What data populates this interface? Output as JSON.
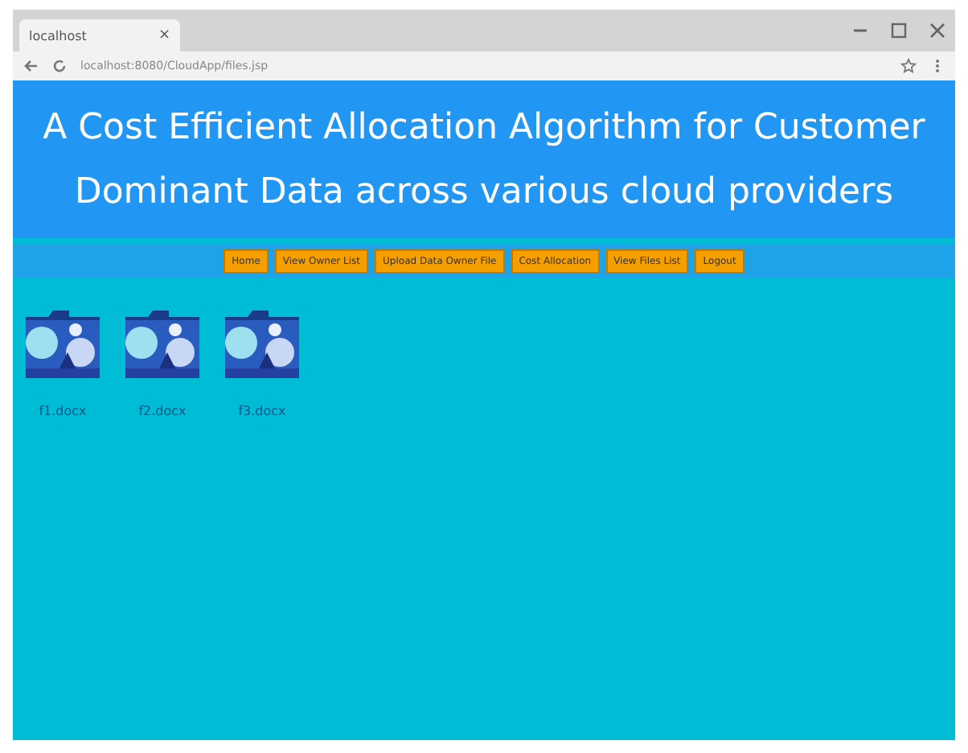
{
  "browser": {
    "tab_title": "localhost",
    "tab_close": "×",
    "address": "localhost:8080/CloudApp/files.jsp"
  },
  "header": {
    "title": "A Cost Efficient Allocation Algorithm for Customer Dominant Data across various cloud providers"
  },
  "nav": [
    "Home",
    "View Owner List",
    "Upload Data Owner File",
    "Cost Allocation",
    "View Files List",
    "Logout"
  ],
  "files": [
    {
      "label": "f1.docx",
      "kind": "picture"
    },
    {
      "label": "f2.docx",
      "kind": "picture"
    },
    {
      "label": "f3.docx",
      "kind": "picture"
    }
  ]
}
